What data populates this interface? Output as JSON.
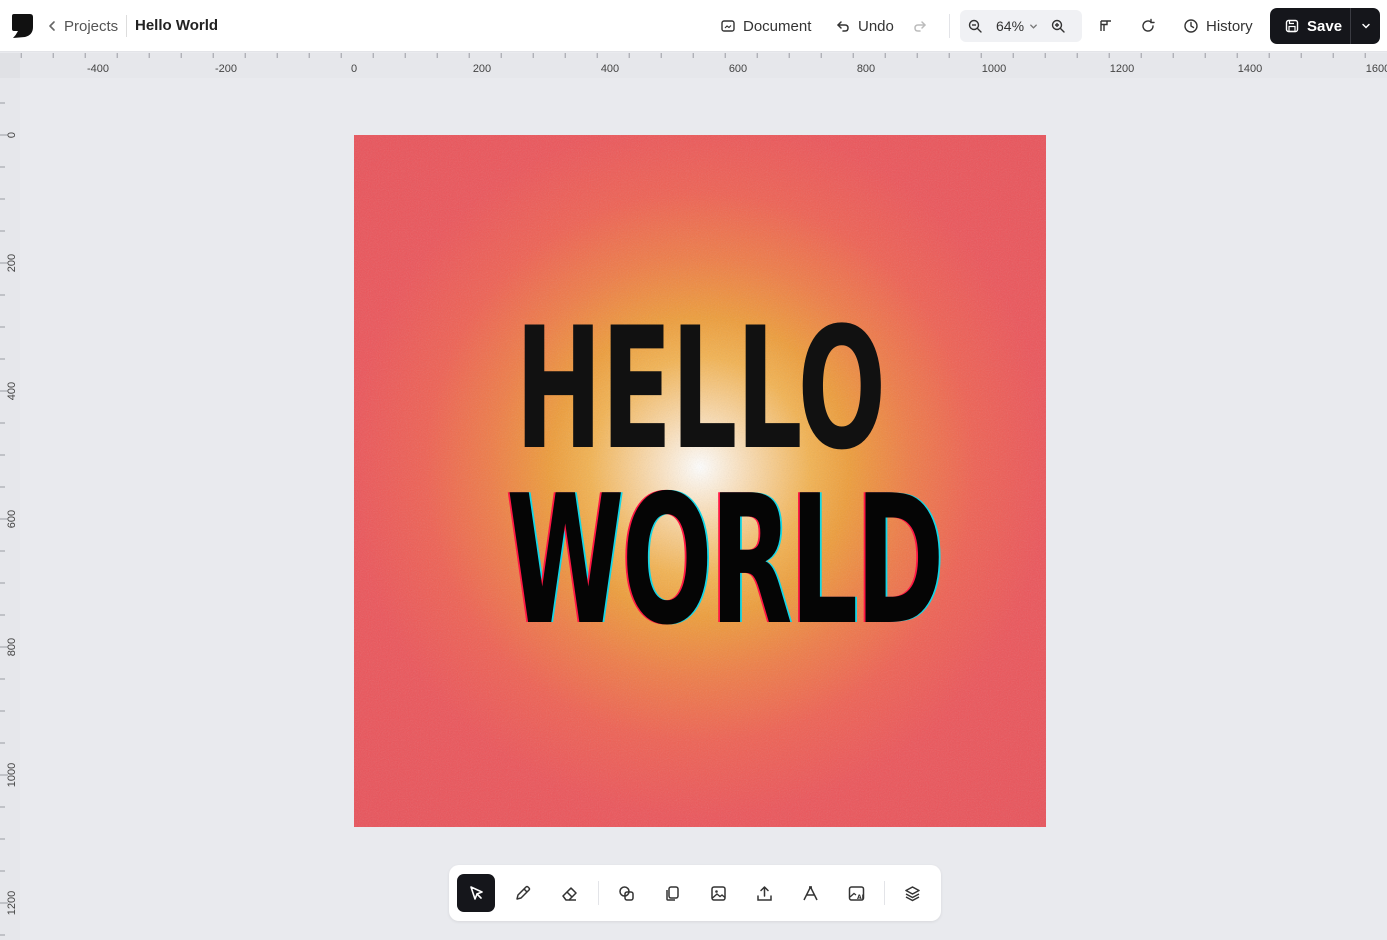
{
  "header": {
    "back_label": "Projects",
    "title": "Hello World",
    "document_label": "Document",
    "undo_label": "Undo",
    "zoom_value": "64%",
    "history_label": "History",
    "save_label": "Save"
  },
  "rulers": {
    "horizontal_ticks": [
      "-400",
      "-200",
      "0",
      "200",
      "400",
      "600",
      "800",
      "1000",
      "1200",
      "1400",
      "1600"
    ],
    "vertical_ticks": [
      "0",
      "200",
      "400",
      "600",
      "800",
      "1000",
      "1200"
    ]
  },
  "artboard": {
    "line1": "HELLO",
    "line2": "WORLD",
    "colors": {
      "edge": "#e9525a",
      "mid": "#ee9d3a",
      "center": "#ffffff"
    }
  },
  "toolbar": {
    "tools": [
      "select-tool",
      "pencil-tool",
      "eraser-tool",
      "shapes-tool",
      "duplicate-tool",
      "image-tool",
      "upload-tool",
      "text-tool",
      "ai-image-tool",
      "layers-tool"
    ],
    "active_tool": "select-tool"
  }
}
